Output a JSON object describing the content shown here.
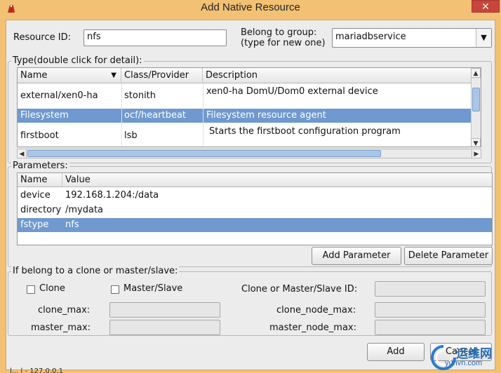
{
  "window": {
    "title": "Add Native Resource",
    "close_glyph": "✕",
    "app_icon": "red-bird-icon"
  },
  "resource_id": {
    "label": "Resource ID:",
    "value": "nfs"
  },
  "group": {
    "label_line1": "Belong to group:",
    "label_line2": "(type for new one)",
    "value": "mariadbservice"
  },
  "type_section": {
    "title": "Type(double click for detail):",
    "columns": [
      "Name",
      "Class/Provider",
      "Description"
    ],
    "rows": [
      {
        "name": "external/xen0-ha",
        "provider": "stonith",
        "description": "xen0-ha DomU/Dom0 external device",
        "selected": false
      },
      {
        "name": "Filesystem",
        "provider": "ocf/heartbeat",
        "description": "Filesystem resource agent",
        "selected": true
      },
      {
        "name": "firstboot",
        "provider": "lsb",
        "description": "Starts the firstboot configuration program",
        "selected": false
      }
    ]
  },
  "parameters": {
    "title": "Parameters:",
    "columns": [
      "Name",
      "Value"
    ],
    "rows": [
      {
        "name": "device",
        "value": "192.168.1.204:/data",
        "selected": false
      },
      {
        "name": "directory",
        "value": "/mydata",
        "selected": false
      },
      {
        "name": "fstype",
        "value": "nfs",
        "selected": true
      }
    ],
    "add_label": "Add Parameter",
    "delete_label": "Delete Parameter"
  },
  "clone_section": {
    "title": "If belong to a clone or master/slave:",
    "clone_label": "Clone",
    "master_slave_label": "Master/Slave",
    "id_label": "Clone or Master/Slave ID:",
    "clone_max_label": "clone_max:",
    "clone_node_max_label": "clone_node_max:",
    "master_max_label": "master_max:",
    "master_node_max_label": "master_node_max:"
  },
  "buttons": {
    "add": "Add",
    "cancel": "Cancel"
  },
  "watermark": {
    "text": "运维网",
    "url": "yunvn.com"
  },
  "peek_text": "l... l - 127.0.0.1"
}
